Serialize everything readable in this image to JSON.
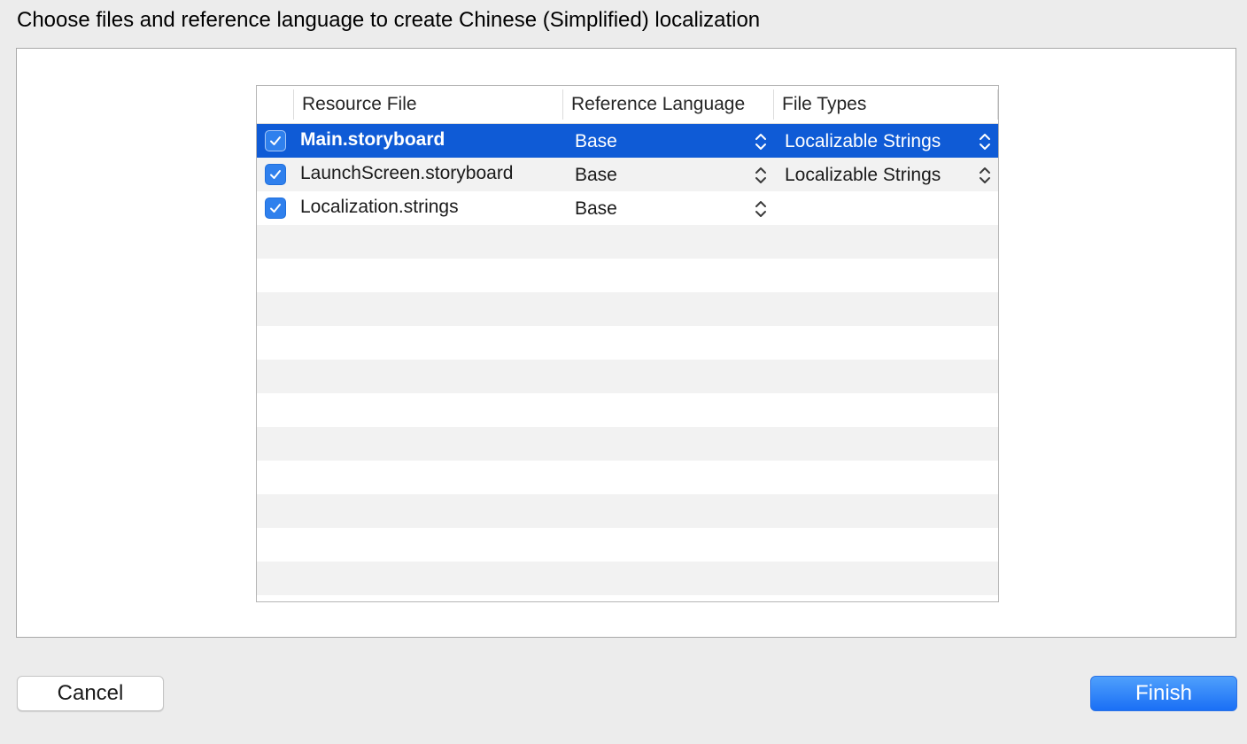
{
  "dialog": {
    "title": "Choose files and reference language to create Chinese (Simplified) localization"
  },
  "table": {
    "columns": {
      "resource_file": "Resource File",
      "reference_language": "Reference Language",
      "file_types": "File Types"
    },
    "rows": [
      {
        "checked": true,
        "file": "Main.storyboard",
        "language": "Base",
        "file_type": "Localizable Strings",
        "selected": true
      },
      {
        "checked": true,
        "file": "LaunchScreen.storyboard",
        "language": "Base",
        "file_type": "Localizable Strings",
        "selected": false
      },
      {
        "checked": true,
        "file": "Localization.strings",
        "language": "Base",
        "file_type": "",
        "selected": false
      }
    ],
    "empty_rows": 11
  },
  "buttons": {
    "cancel": "Cancel",
    "finish": "Finish"
  },
  "icons": {
    "checkbox": "checkmark-icon",
    "popup": "up-down-chevron-icon"
  },
  "colors": {
    "selection": "#0f5bd6",
    "checkbox": "#2f80ed",
    "finish_button": "#1a6ff5",
    "window_background": "#ececec"
  }
}
